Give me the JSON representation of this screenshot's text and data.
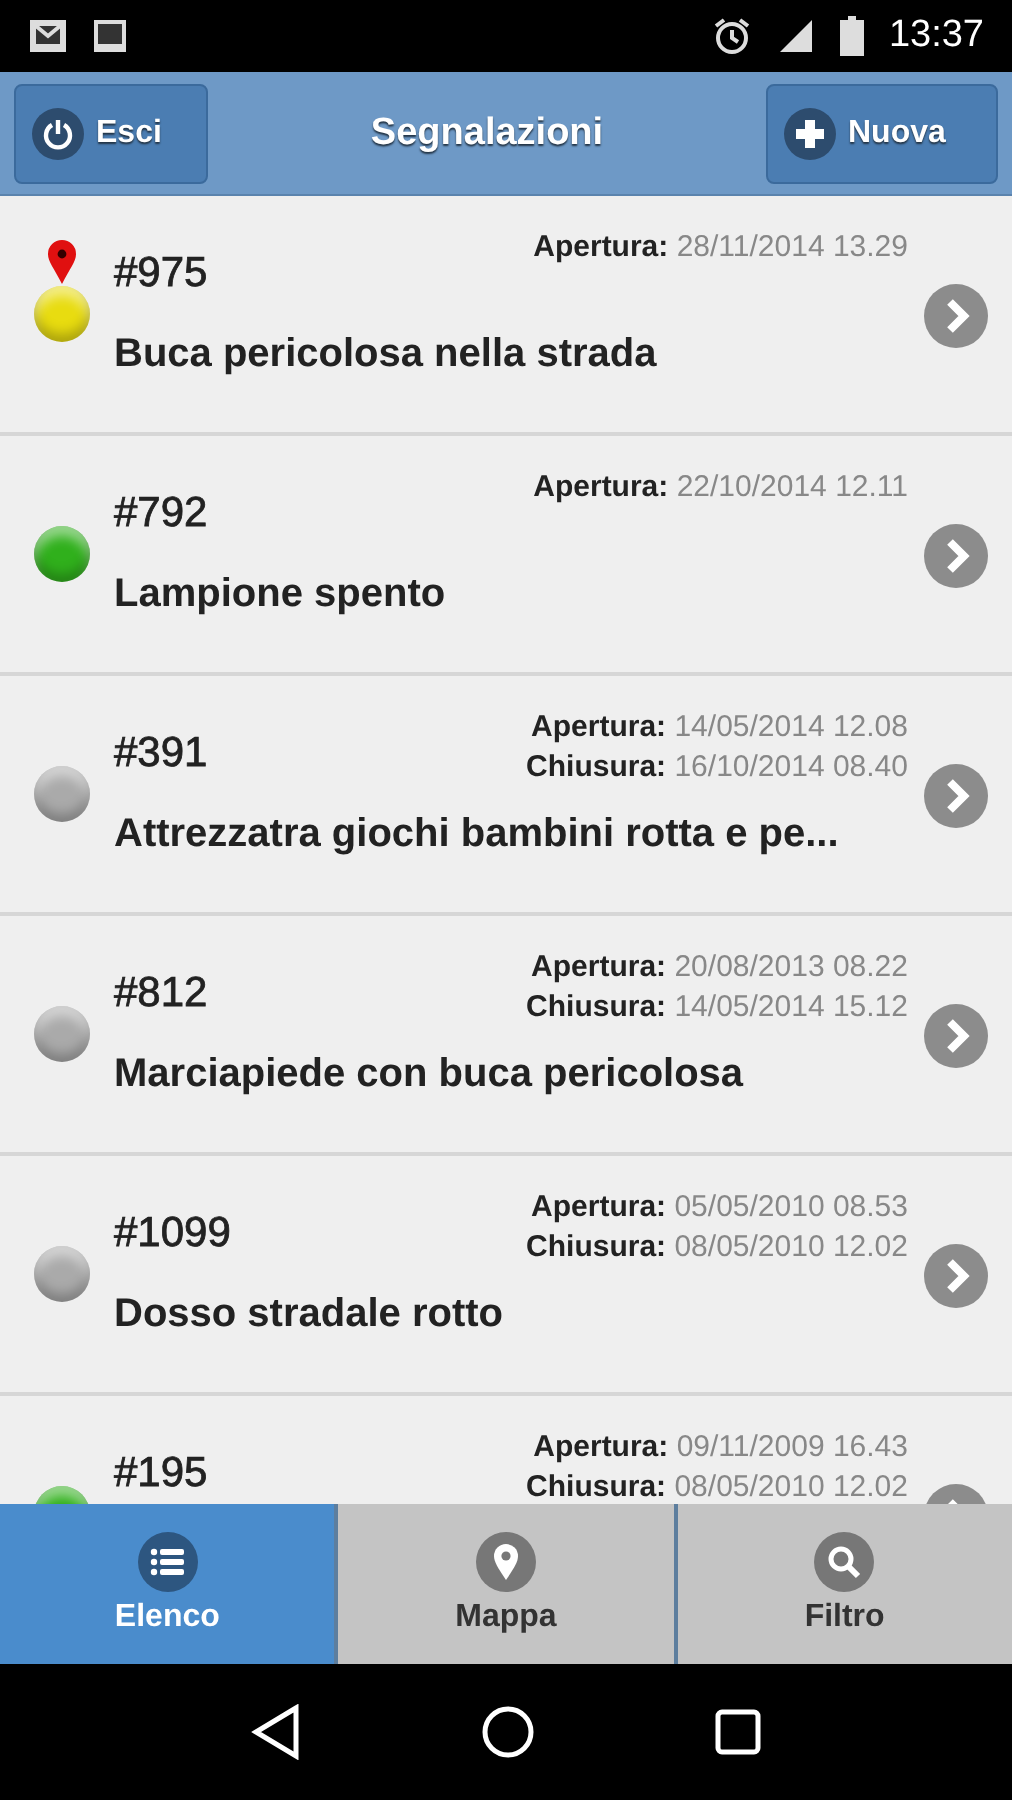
{
  "status_bar": {
    "time": "13:37"
  },
  "header": {
    "title": "Segnalazioni",
    "left_button": "Esci",
    "right_button": "Nuova"
  },
  "reports": [
    {
      "number": "#975",
      "color": "#e8dc10",
      "pinned": true,
      "dates": [
        {
          "label": "Apertura:",
          "value": "28/11/2014 13.29"
        }
      ],
      "title": "Buca pericolosa nella strada"
    },
    {
      "number": "#792",
      "color": "#30b01c",
      "pinned": false,
      "dates": [
        {
          "label": "Apertura:",
          "value": "22/10/2014 12.11"
        }
      ],
      "title": "Lampione spento"
    },
    {
      "number": "#391",
      "color": "#aaaaaa",
      "pinned": false,
      "dates": [
        {
          "label": "Apertura:",
          "value": "14/05/2014 12.08"
        },
        {
          "label": "Chiusura:",
          "value": "16/10/2014 08.40"
        }
      ],
      "title": "Attrezzatra giochi bambini rotta e pe..."
    },
    {
      "number": "#812",
      "color": "#aaaaaa",
      "pinned": false,
      "dates": [
        {
          "label": "Apertura:",
          "value": "20/08/2013 08.22"
        },
        {
          "label": "Chiusura:",
          "value": "14/05/2014 15.12"
        }
      ],
      "title": "Marciapiede con buca pericolosa"
    },
    {
      "number": "#1099",
      "color": "#aaaaaa",
      "pinned": false,
      "dates": [
        {
          "label": "Apertura:",
          "value": "05/05/2010 08.53"
        },
        {
          "label": "Chiusura:",
          "value": "08/05/2010 12.02"
        }
      ],
      "title": "Dosso stradale rotto"
    },
    {
      "number": "#195",
      "color": "#30b01c",
      "pinned": false,
      "dates": [
        {
          "label": "Apertura:",
          "value": "09/11/2009 16.43"
        },
        {
          "label": "Chiusura:",
          "value": "08/05/2010 12.02"
        }
      ]
    }
  ],
  "tabs": [
    {
      "label": "Elenco",
      "kind": "list",
      "selected": true
    },
    {
      "label": "Mappa",
      "kind": "map",
      "selected": false
    },
    {
      "label": "Filtro",
      "kind": "search",
      "selected": false
    }
  ]
}
